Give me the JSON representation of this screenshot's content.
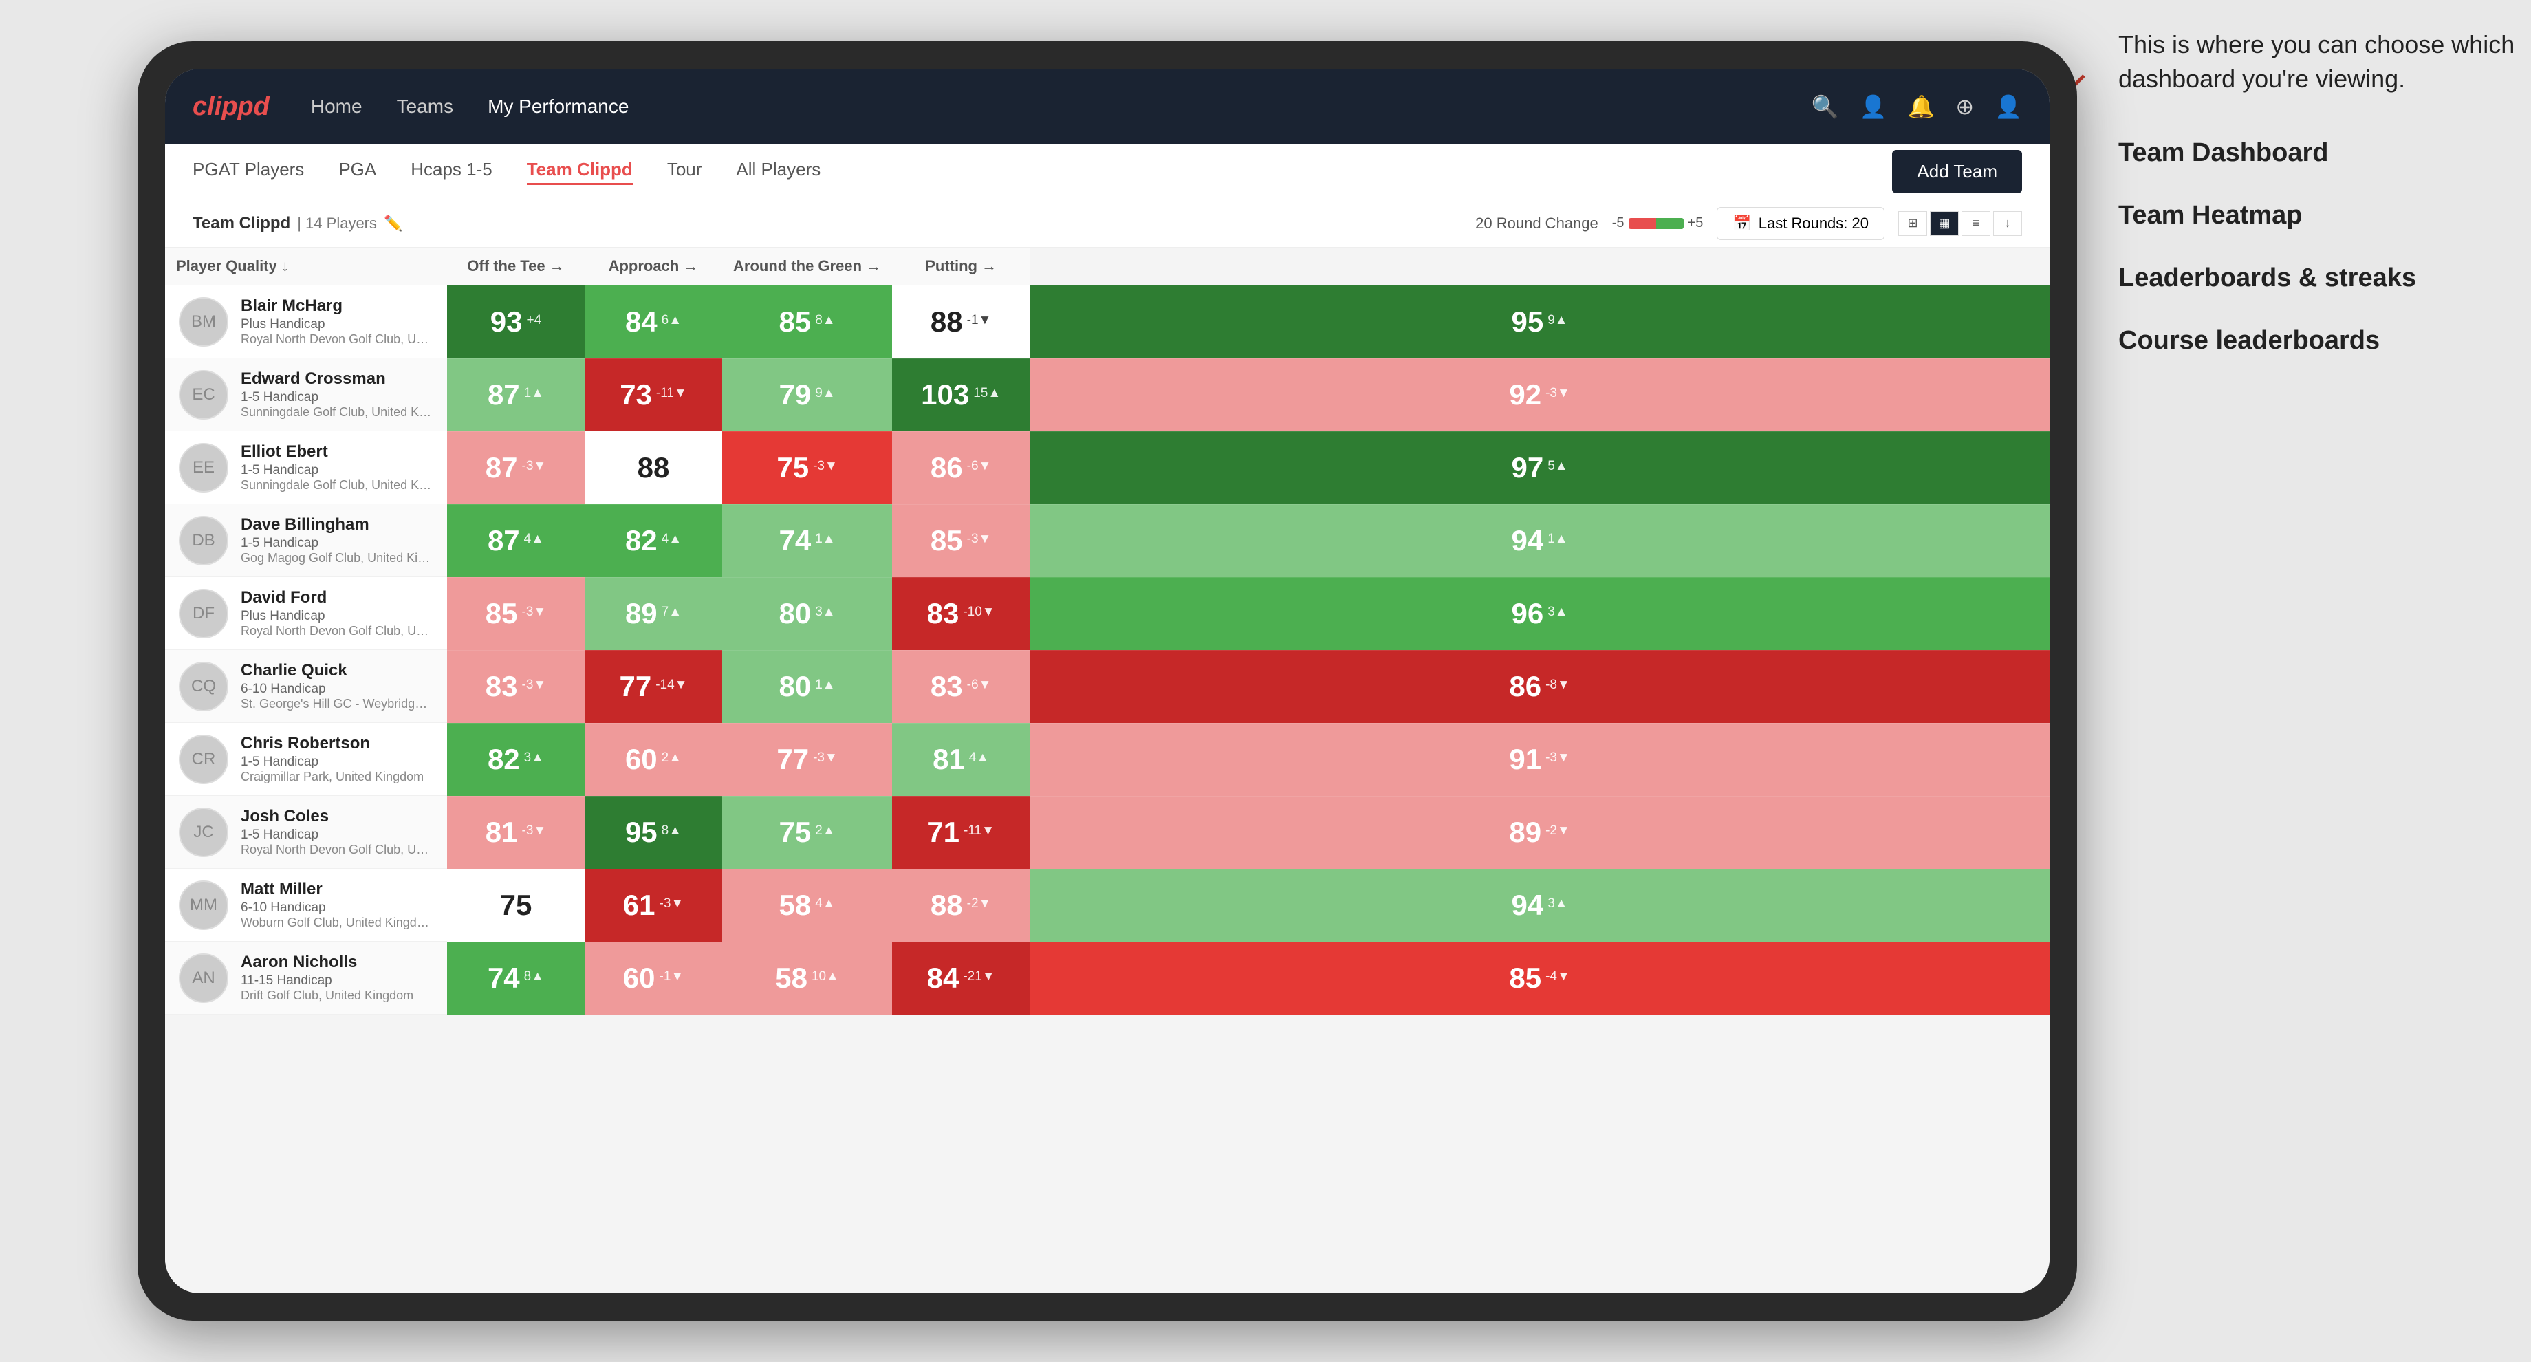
{
  "annotation": {
    "callout": "This is where you can choose which dashboard you're viewing.",
    "items": [
      {
        "label": "Team Dashboard"
      },
      {
        "label": "Team Heatmap"
      },
      {
        "label": "Leaderboards & streaks"
      },
      {
        "label": "Course leaderboards"
      }
    ]
  },
  "navbar": {
    "logo": "clippd",
    "links": [
      {
        "label": "Home",
        "active": false
      },
      {
        "label": "Teams",
        "active": false
      },
      {
        "label": "My Performance",
        "active": false
      }
    ],
    "icons": [
      "search",
      "person",
      "bell",
      "circle-plus",
      "avatar"
    ]
  },
  "subnav": {
    "links": [
      {
        "label": "PGAT Players",
        "active": false
      },
      {
        "label": "PGA",
        "active": false
      },
      {
        "label": "Hcaps 1-5",
        "active": false
      },
      {
        "label": "Team Clippd",
        "active": true
      },
      {
        "label": "Tour",
        "active": false
      },
      {
        "label": "All Players",
        "active": false
      }
    ],
    "add_team_label": "Add Team"
  },
  "team_header": {
    "name": "Team Clippd",
    "separator": "|",
    "player_count": "14 Players",
    "round_change_label": "20 Round Change",
    "scale_min": "-5",
    "scale_max": "+5",
    "last_rounds_label": "Last Rounds:",
    "last_rounds_value": "20",
    "views": [
      "grid-small",
      "grid-large",
      "heatmap",
      "download"
    ]
  },
  "table": {
    "columns": [
      {
        "label": "Player Quality ↓",
        "key": "quality"
      },
      {
        "label": "Off the Tee →",
        "key": "offTee"
      },
      {
        "label": "Approach →",
        "key": "approach"
      },
      {
        "label": "Around the Green →",
        "key": "aroundGreen"
      },
      {
        "label": "Putting →",
        "key": "putting"
      }
    ],
    "rows": [
      {
        "name": "Blair McHarg",
        "handicap": "Plus Handicap",
        "club": "Royal North Devon Golf Club, United Kingdom",
        "quality": {
          "value": 93,
          "change": "+4",
          "dir": "up",
          "bg": "green-dark"
        },
        "offTee": {
          "value": 84,
          "change": "6▲",
          "dir": "up",
          "bg": "green-mid"
        },
        "approach": {
          "value": 85,
          "change": "8▲",
          "dir": "up",
          "bg": "green-mid"
        },
        "aroundGreen": {
          "value": 88,
          "change": "-1▼",
          "dir": "down",
          "bg": "white"
        },
        "putting": {
          "value": 95,
          "change": "9▲",
          "dir": "up",
          "bg": "green-dark"
        }
      },
      {
        "name": "Edward Crossman",
        "handicap": "1-5 Handicap",
        "club": "Sunningdale Golf Club, United Kingdom",
        "quality": {
          "value": 87,
          "change": "1▲",
          "dir": "up",
          "bg": "green-light"
        },
        "offTee": {
          "value": 73,
          "change": "-11▼",
          "dir": "down",
          "bg": "red-dark"
        },
        "approach": {
          "value": 79,
          "change": "9▲",
          "dir": "up",
          "bg": "green-light"
        },
        "aroundGreen": {
          "value": 103,
          "change": "15▲",
          "dir": "up",
          "bg": "green-dark"
        },
        "putting": {
          "value": 92,
          "change": "-3▼",
          "dir": "down",
          "bg": "red-light"
        }
      },
      {
        "name": "Elliot Ebert",
        "handicap": "1-5 Handicap",
        "club": "Sunningdale Golf Club, United Kingdom",
        "quality": {
          "value": 87,
          "change": "-3▼",
          "dir": "down",
          "bg": "red-light"
        },
        "offTee": {
          "value": 88,
          "change": "",
          "dir": "",
          "bg": "white"
        },
        "approach": {
          "value": 75,
          "change": "-3▼",
          "dir": "down",
          "bg": "red-mid"
        },
        "aroundGreen": {
          "value": 86,
          "change": "-6▼",
          "dir": "down",
          "bg": "red-light"
        },
        "putting": {
          "value": 97,
          "change": "5▲",
          "dir": "up",
          "bg": "green-dark"
        }
      },
      {
        "name": "Dave Billingham",
        "handicap": "1-5 Handicap",
        "club": "Gog Magog Golf Club, United Kingdom",
        "quality": {
          "value": 87,
          "change": "4▲",
          "dir": "up",
          "bg": "green-mid"
        },
        "offTee": {
          "value": 82,
          "change": "4▲",
          "dir": "up",
          "bg": "green-mid"
        },
        "approach": {
          "value": 74,
          "change": "1▲",
          "dir": "up",
          "bg": "green-light"
        },
        "aroundGreen": {
          "value": 85,
          "change": "-3▼",
          "dir": "down",
          "bg": "red-light"
        },
        "putting": {
          "value": 94,
          "change": "1▲",
          "dir": "up",
          "bg": "green-light"
        }
      },
      {
        "name": "David Ford",
        "handicap": "Plus Handicap",
        "club": "Royal North Devon Golf Club, United Kingdom",
        "quality": {
          "value": 85,
          "change": "-3▼",
          "dir": "down",
          "bg": "red-light"
        },
        "offTee": {
          "value": 89,
          "change": "7▲",
          "dir": "up",
          "bg": "green-light"
        },
        "approach": {
          "value": 80,
          "change": "3▲",
          "dir": "up",
          "bg": "green-light"
        },
        "aroundGreen": {
          "value": 83,
          "change": "-10▼",
          "dir": "down",
          "bg": "red-dark"
        },
        "putting": {
          "value": 96,
          "change": "3▲",
          "dir": "up",
          "bg": "green-mid"
        }
      },
      {
        "name": "Charlie Quick",
        "handicap": "6-10 Handicap",
        "club": "St. George's Hill GC - Weybridge - Surrey, Uni...",
        "quality": {
          "value": 83,
          "change": "-3▼",
          "dir": "down",
          "bg": "red-light"
        },
        "offTee": {
          "value": 77,
          "change": "-14▼",
          "dir": "down",
          "bg": "red-dark"
        },
        "approach": {
          "value": 80,
          "change": "1▲",
          "dir": "up",
          "bg": "green-light"
        },
        "aroundGreen": {
          "value": 83,
          "change": "-6▼",
          "dir": "down",
          "bg": "red-light"
        },
        "putting": {
          "value": 86,
          "change": "-8▼",
          "dir": "down",
          "bg": "red-dark"
        }
      },
      {
        "name": "Chris Robertson",
        "handicap": "1-5 Handicap",
        "club": "Craigmillar Park, United Kingdom",
        "quality": {
          "value": 82,
          "change": "3▲",
          "dir": "up",
          "bg": "green-mid"
        },
        "offTee": {
          "value": 60,
          "change": "2▲",
          "dir": "up",
          "bg": "red-light"
        },
        "approach": {
          "value": 77,
          "change": "-3▼",
          "dir": "down",
          "bg": "red-light"
        },
        "aroundGreen": {
          "value": 81,
          "change": "4▲",
          "dir": "up",
          "bg": "green-light"
        },
        "putting": {
          "value": 91,
          "change": "-3▼",
          "dir": "down",
          "bg": "red-light"
        }
      },
      {
        "name": "Josh Coles",
        "handicap": "1-5 Handicap",
        "club": "Royal North Devon Golf Club, United Kingdom",
        "quality": {
          "value": 81,
          "change": "-3▼",
          "dir": "down",
          "bg": "red-light"
        },
        "offTee": {
          "value": 95,
          "change": "8▲",
          "dir": "up",
          "bg": "green-dark"
        },
        "approach": {
          "value": 75,
          "change": "2▲",
          "dir": "up",
          "bg": "green-light"
        },
        "aroundGreen": {
          "value": 71,
          "change": "-11▼",
          "dir": "down",
          "bg": "red-dark"
        },
        "putting": {
          "value": 89,
          "change": "-2▼",
          "dir": "down",
          "bg": "red-light"
        }
      },
      {
        "name": "Matt Miller",
        "handicap": "6-10 Handicap",
        "club": "Woburn Golf Club, United Kingdom",
        "quality": {
          "value": 75,
          "change": "",
          "dir": "",
          "bg": "white"
        },
        "offTee": {
          "value": 61,
          "change": "-3▼",
          "dir": "down",
          "bg": "red-dark"
        },
        "approach": {
          "value": 58,
          "change": "4▲",
          "dir": "up",
          "bg": "red-light"
        },
        "aroundGreen": {
          "value": 88,
          "change": "-2▼",
          "dir": "down",
          "bg": "red-light"
        },
        "putting": {
          "value": 94,
          "change": "3▲",
          "dir": "up",
          "bg": "green-light"
        }
      },
      {
        "name": "Aaron Nicholls",
        "handicap": "11-15 Handicap",
        "club": "Drift Golf Club, United Kingdom",
        "quality": {
          "value": 74,
          "change": "8▲",
          "dir": "up",
          "bg": "green-mid"
        },
        "offTee": {
          "value": 60,
          "change": "-1▼",
          "dir": "down",
          "bg": "red-light"
        },
        "approach": {
          "value": 58,
          "change": "10▲",
          "dir": "up",
          "bg": "red-light"
        },
        "aroundGreen": {
          "value": 84,
          "change": "-21▼",
          "dir": "down",
          "bg": "red-dark"
        },
        "putting": {
          "value": 85,
          "change": "-4▼",
          "dir": "down",
          "bg": "red-mid"
        }
      }
    ]
  }
}
